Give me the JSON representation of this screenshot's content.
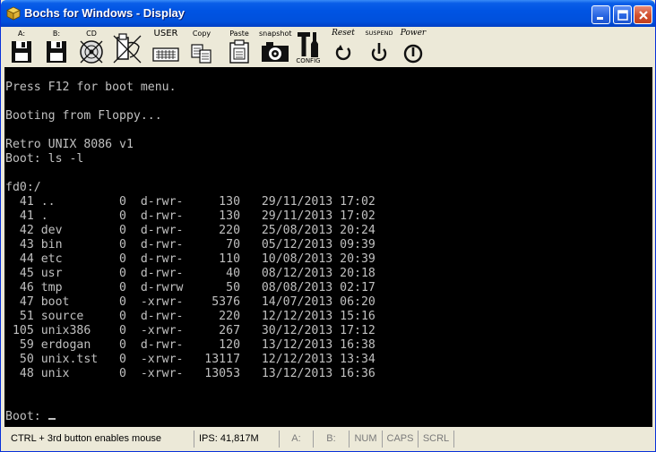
{
  "window": {
    "title": "Bochs for Windows - Display",
    "app_icon": "bochs-cube-icon"
  },
  "toolbar": {
    "floppy_a_label": "A:",
    "floppy_b_label": "B:",
    "cdrom_label": "CD",
    "usb_label": "",
    "user_label": "USER",
    "copy_label": "Copy",
    "paste_label": "Paste",
    "snapshot_label": "snapshot",
    "config_label": "CONFIG",
    "reset_label": "Reset",
    "suspend_label": "SUSPEND",
    "power_label": "Power"
  },
  "console": {
    "lines": [
      "Press F12 for boot menu.",
      "",
      "Booting from Floppy...",
      "",
      "Retro UNIX 8086 v1",
      "Boot: ls -l",
      "",
      "fd0:/",
      "  41 ..         0  d-rwr-     130   29/11/2013 17:02",
      "  41 .          0  d-rwr-     130   29/11/2013 17:02",
      "  42 dev        0  d-rwr-     220   25/08/2013 20:24",
      "  43 bin        0  d-rwr-      70   05/12/2013 09:39",
      "  44 etc        0  d-rwr-     110   10/08/2013 20:39",
      "  45 usr        0  d-rwr-      40   08/12/2013 20:18",
      "  46 tmp        0  d-rwrw      50   08/08/2013 02:17",
      "  47 boot       0  -xrwr-    5376   14/07/2013 06:20",
      "  51 source     0  d-rwr-     220   12/12/2013 15:16",
      " 105 unix386    0  -xrwr-     267   30/12/2013 17:12",
      "  59 erdogan    0  d-rwr-     120   13/12/2013 16:38",
      "  50 unix.tst   0  -xrwr-   13117   12/12/2013 13:34",
      "  48 unix       0  -xrwr-   13053   13/12/2013 16:36",
      "",
      ""
    ],
    "prompt": "Boot: "
  },
  "statusbar": {
    "hint": "CTRL + 3rd button enables mouse",
    "ips": "IPS: 41,817M",
    "led_a": "A:",
    "led_b": "B:",
    "num": "NUM",
    "caps": "CAPS",
    "scrl": "SCRL"
  },
  "colors": {
    "titlebar": "#0054e3",
    "screen_bg": "#000000",
    "screen_text": "#c0c0c0",
    "chrome": "#ece9d8"
  }
}
